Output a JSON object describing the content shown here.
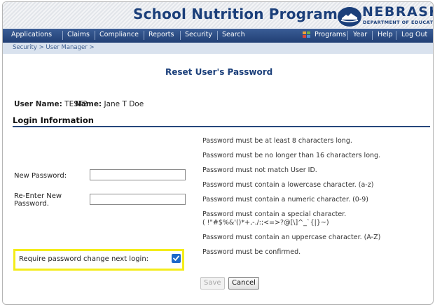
{
  "header": {
    "app_title": "School Nutrition Programs",
    "logo_name": "NEBRASKA",
    "logo_sub": "DEPARTMENT OF EDUCATION"
  },
  "nav": {
    "applications": "Applications",
    "claims": "Claims",
    "compliance": "Compliance",
    "reports": "Reports",
    "security": "Security",
    "search": "Search",
    "programs": "Programs",
    "year": "Year",
    "help": "Help",
    "logout": "Log Out"
  },
  "breadcrumb": "Security > User Manager >",
  "page": {
    "title": "Reset User's Password",
    "user_name_label": "User Name:",
    "user_name_value": "TEST2",
    "name_label": "Name:",
    "name_value": "Jane T Doe",
    "section_title": "Login Information"
  },
  "form": {
    "new_password_label": "New Password:",
    "new_password_value": "",
    "reenter_label_line1": "Re-Enter New",
    "reenter_label_line2": "Password.",
    "reenter_value": "",
    "require_change_label": "Require password change next login:",
    "require_change_checked": true
  },
  "rules": [
    "Password must be at least 8 characters long.",
    "Password must be no longer than 16 characters long.",
    "Password must not match User ID.",
    "Password must contain a lowercase character. (a-z)",
    "Password must contain a numeric character. (0-9)",
    "Password must contain a special character.",
    "( !\"#$%&'()*+,-./:;<=>?@[\\]^_`{|}~)",
    "Password must contain an uppercase character. (A-Z)",
    "Password must be confirmed."
  ],
  "buttons": {
    "save": "Save",
    "cancel": "Cancel"
  },
  "colors": {
    "brand_navy": "#1b3f7a",
    "highlight_yellow": "#f4ec1a",
    "checkbox_blue": "#1d68c9"
  }
}
